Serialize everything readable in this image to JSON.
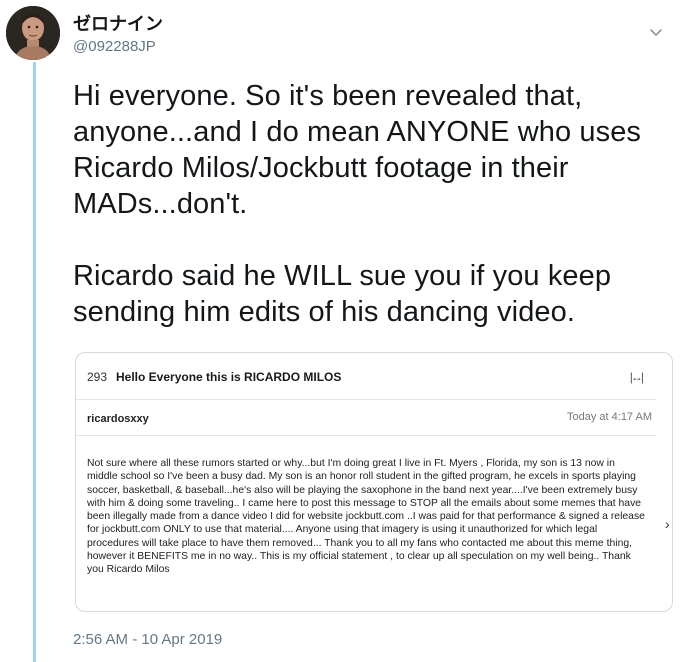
{
  "author": {
    "display_name": "ゼロナイン",
    "handle": "@092288JP"
  },
  "tweet": {
    "paragraph1": "Hi everyone. So it's been revealed that, anyone...and I do mean ANYONE who uses Ricardo Milos/Jockbutt footage in their MADs...don't.",
    "paragraph2": "Ricardo said he WILL sue you if you keep sending him edits of his dancing video.",
    "timestamp": "2:56 AM - 10 Apr 2019"
  },
  "media": {
    "message_number": "293",
    "subject": "Hello Everyone this is RICARDO MILOS",
    "expand_icon": "expand-arrows-icon",
    "sender": "ricardosxxy",
    "sent_time": "Today at 4:17 AM",
    "body": "Not sure where all these rumors started or why...but I'm doing great I live in Ft. Myers , Florida, my son is 13 now in middle school so I've been a busy dad. My son is an honor roll student in the gifted program, he excels in sports playing soccer, basketball, & baseball...he's also will be playing the saxophone in the band next year....I've been extremely busy with him & doing some traveling.. I came here to post this message to STOP all the emails about some memes that have been illegally made from a dance video I did for website jockbutt.com ..I was paid for that performance & signed a release for jockbutt.com ONLY to use that material.... Anyone using that imagery is using it unauthorized for which legal procedures will take place to have them removed... Thank you to all my fans who contacted me about this meme thing, however it BENEFITS me in no way.. This is my official statement , to clear up all speculation on my well being.. Thank you Ricardo Milos"
  },
  "icons": {
    "chevron": "chevron-down-icon",
    "next": "chevron-right-icon"
  },
  "colors": {
    "thread_line": "#9fd3f4",
    "muted_text": "#657786",
    "primary_text": "#14171a"
  }
}
